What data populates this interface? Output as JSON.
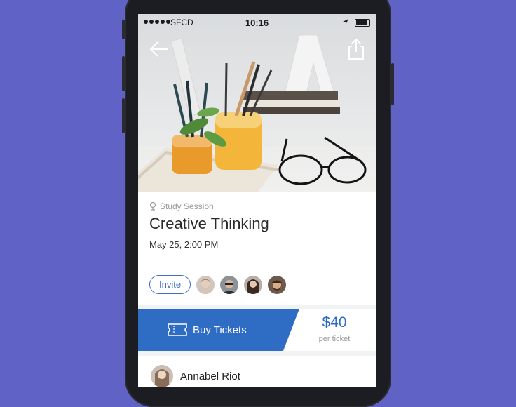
{
  "status_bar": {
    "carrier": "SFCD",
    "time": "10:16"
  },
  "event": {
    "category": "Study Session",
    "title": "Creative Thinking",
    "datetime": "May 25, 2:00 PM"
  },
  "invite": {
    "label": "Invite"
  },
  "tickets": {
    "buy_label": "Buy Tickets",
    "price": "$40",
    "per_label": "per ticket"
  },
  "host": {
    "name": "Annabel Riot"
  },
  "colors": {
    "background": "#6162c6",
    "accent": "#2f6cc4"
  }
}
